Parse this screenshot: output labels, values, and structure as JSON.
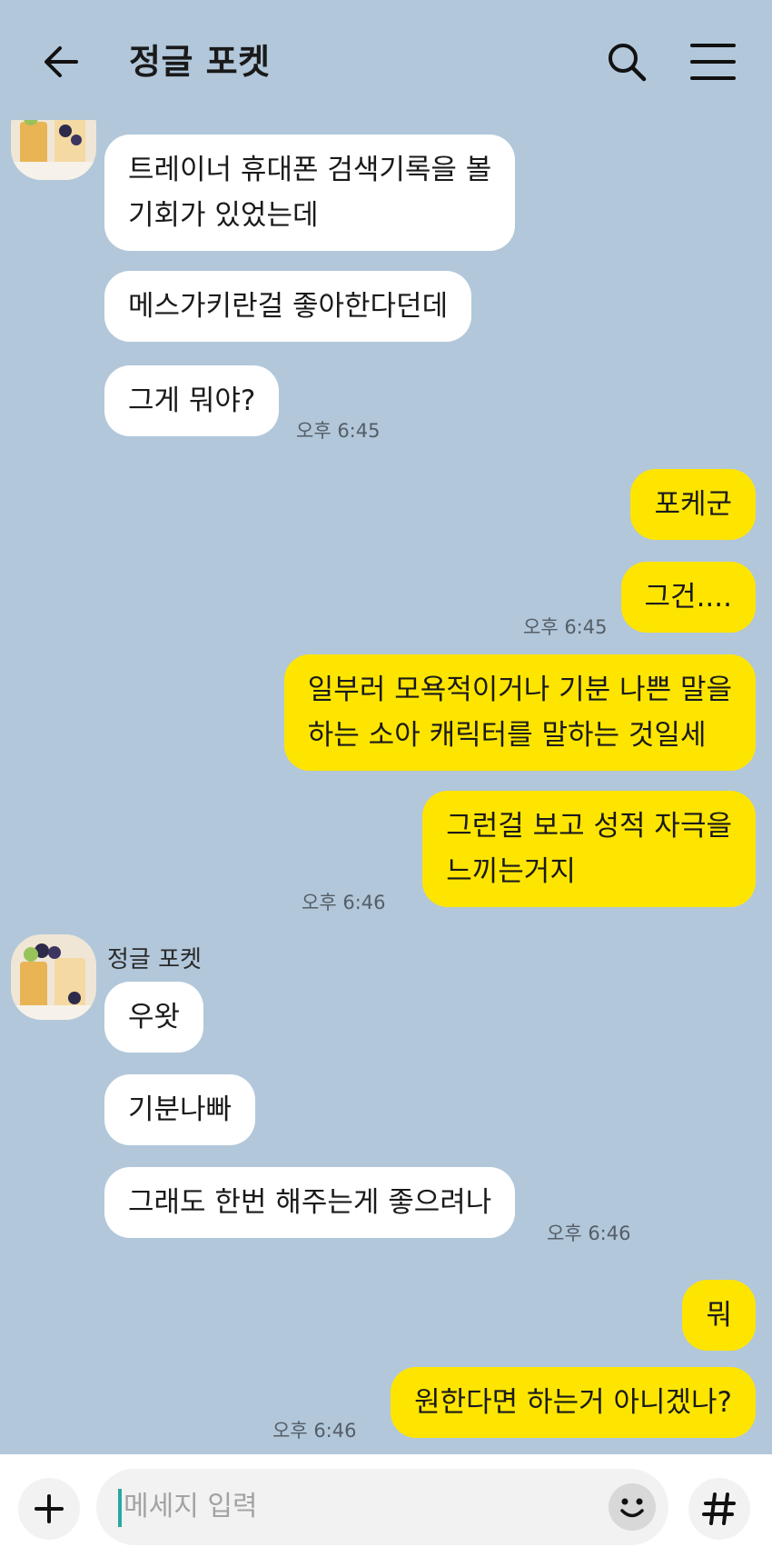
{
  "header": {
    "title": "정글 포켓"
  },
  "sender": {
    "name": "정글 포켓"
  },
  "messages": {
    "m1": "트레이너 휴대폰 검색기록을 볼",
    "m1b": "기회가 있었는데",
    "m2": "메스가키란걸 좋아한다던데",
    "m3": "그게 뭐야?",
    "t1": "오후 6:45",
    "m4": "포케군",
    "m5": "그건....",
    "t2": "오후 6:45",
    "m6": "일부러 모욕적이거나 기분 나쁜 말을",
    "m6b": "하는 소아 캐릭터를 말하는 것일세",
    "m7": "그런걸 보고 성적 자극을",
    "m7b": "느끼는거지",
    "t3": "오후 6:46",
    "m8": "우왓",
    "m9": "기분나빠",
    "m10": "그래도 한번 해주는게 좋으려나",
    "t4": "오후 6:46",
    "m11": "뭐",
    "m12": "원한다면 하는거 아니겠나?",
    "t5": "오후 6:46"
  },
  "composer": {
    "placeholder": "메세지 입력"
  },
  "icons": {
    "back": "arrow-left-icon",
    "search": "search-icon",
    "menu": "hamburger-menu-icon",
    "plus": "plus-icon",
    "emoji": "emoji-icon",
    "hash": "hashtag-icon"
  },
  "colors": {
    "background": "#b2c7da",
    "incoming_bubble": "#ffffff",
    "outgoing_bubble": "#fee500"
  }
}
